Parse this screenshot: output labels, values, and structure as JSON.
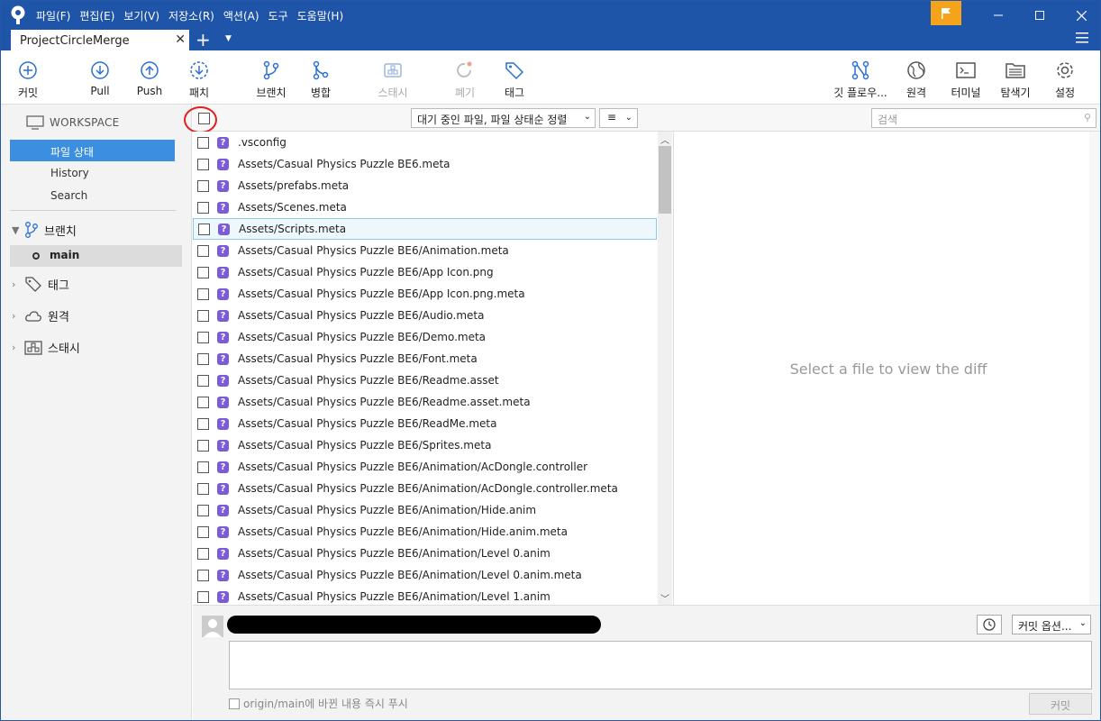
{
  "menu": [
    "파일(F)",
    "편집(E)",
    "보기(V)",
    "저장소(R)",
    "액션(A)",
    "도구",
    "도움말(H)"
  ],
  "tab": {
    "title": "ProjectCircleMerge"
  },
  "toolbar": {
    "commit": "커밋",
    "pull": "Pull",
    "push": "Push",
    "fetch": "패치",
    "branch": "브랜치",
    "merge": "병합",
    "stash": "스태시",
    "discard": "폐기",
    "tag": "태그",
    "gitflow": "깃 플로우...",
    "remote": "원격",
    "terminal": "터미널",
    "explorer": "탐색기",
    "settings": "설정"
  },
  "sidebar": {
    "workspace": "WORKSPACE",
    "items": [
      "파일 상태",
      "History",
      "Search"
    ],
    "branches": "브랜치",
    "branch_main": "main",
    "tags": "태그",
    "remotes": "원격",
    "stashes": "스태시"
  },
  "filebar": {
    "sort": "대기 중인 파일, 파일 상태순 정렬",
    "view": "≡",
    "search_placeholder": "검색"
  },
  "files": [
    ".vsconfig",
    "Assets/Casual Physics Puzzle BE6.meta",
    "Assets/prefabs.meta",
    "Assets/Scenes.meta",
    "Assets/Scripts.meta",
    "Assets/Casual Physics Puzzle BE6/Animation.meta",
    "Assets/Casual Physics Puzzle BE6/App Icon.png",
    "Assets/Casual Physics Puzzle BE6/App Icon.png.meta",
    "Assets/Casual Physics Puzzle BE6/Audio.meta",
    "Assets/Casual Physics Puzzle BE6/Demo.meta",
    "Assets/Casual Physics Puzzle BE6/Font.meta",
    "Assets/Casual Physics Puzzle BE6/Readme.asset",
    "Assets/Casual Physics Puzzle BE6/Readme.asset.meta",
    "Assets/Casual Physics Puzzle BE6/ReadMe.meta",
    "Assets/Casual Physics Puzzle BE6/Sprites.meta",
    "Assets/Casual Physics Puzzle BE6/Animation/AcDongle.controller",
    "Assets/Casual Physics Puzzle BE6/Animation/AcDongle.controller.meta",
    "Assets/Casual Physics Puzzle BE6/Animation/Hide.anim",
    "Assets/Casual Physics Puzzle BE6/Animation/Hide.anim.meta",
    "Assets/Casual Physics Puzzle BE6/Animation/Level 0.anim",
    "Assets/Casual Physics Puzzle BE6/Animation/Level 0.anim.meta",
    "Assets/Casual Physics Puzzle BE6/Animation/Level 1.anim"
  ],
  "diff": {
    "placeholder": "Select a file to view the diff"
  },
  "commit": {
    "options": "커밋 옵션...",
    "push_option": "origin/main에 바뀐 내용 즉시 푸시",
    "button": "커밋"
  },
  "colors": {
    "titlebar": "#1f55a8",
    "accent": "#3c8fe0",
    "untracked": "#7b5bd6",
    "flag": "#f5a31b"
  }
}
